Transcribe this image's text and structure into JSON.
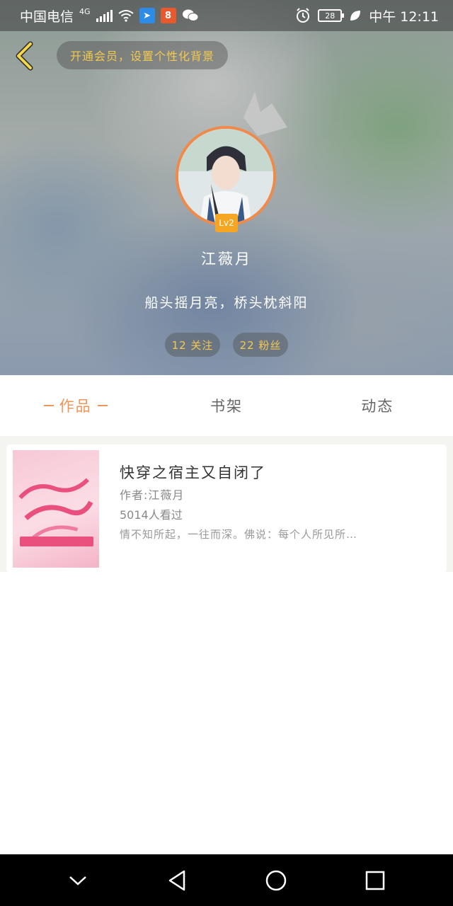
{
  "status_bar": {
    "carrier": "中国电信",
    "network": "4G",
    "battery": "28",
    "time": "中午 12:11",
    "icons": [
      "signal-icon",
      "wifi-icon",
      "app-notification-icon",
      "app-notification-icon",
      "wechat-icon",
      "alarm-icon",
      "battery-icon",
      "leaf-icon"
    ]
  },
  "header": {
    "vip_banner": "开通会员，设置个性化背景",
    "level": "Lv2",
    "username": "江薇月",
    "bio": "船头摇月亮，桥头枕斜阳",
    "follow_label": "12 关注",
    "fans_label": "22 粉丝"
  },
  "tabs": [
    {
      "label": "作品",
      "active": true
    },
    {
      "label": "书架",
      "active": false
    },
    {
      "label": "动态",
      "active": false
    }
  ],
  "works": [
    {
      "title": "快穿之宿主又自闭了",
      "author": "作者:江薇月",
      "views": "5014人看过",
      "description": "情不知所起，一往而深。佛说：每个人所见所…"
    }
  ],
  "colors": {
    "accent": "#f0955a",
    "gold": "#f3c94f",
    "avatar_ring": "#f08a4b",
    "level_badge": "#f5a623"
  },
  "nav": [
    "chevron-down-icon",
    "back-triangle-icon",
    "home-circle-icon",
    "recents-square-icon"
  ]
}
